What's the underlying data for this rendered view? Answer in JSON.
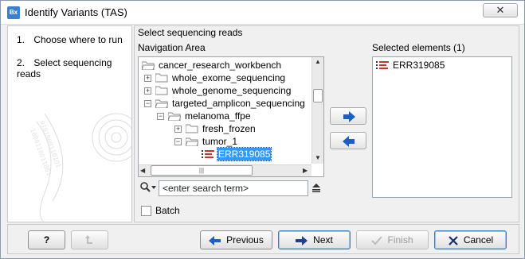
{
  "window": {
    "title": "Identify Variants (TAS)",
    "app_icon_text": "Bx",
    "close_glyph": "✕"
  },
  "steps": [
    {
      "num": "1.",
      "label": "Choose where to run"
    },
    {
      "num": "2.",
      "label": "Select sequencing reads"
    }
  ],
  "main": {
    "section_title": "Select sequencing reads",
    "navigation_label": "Navigation Area",
    "selected_label": "Selected elements (1)"
  },
  "tree": {
    "items": [
      {
        "label": "cancer_research_workbench",
        "icon": "folder-open-icon",
        "expander": ""
      },
      {
        "label": "whole_exome_sequencing",
        "icon": "folder-icon",
        "expander": "+"
      },
      {
        "label": "whole_genome_sequencing",
        "icon": "folder-icon",
        "expander": "+"
      },
      {
        "label": "targeted_amplicon_sequencing",
        "icon": "folder-open-icon",
        "expander": "−"
      },
      {
        "label": "melanoma_ffpe",
        "icon": "folder-open-icon",
        "expander": "−"
      },
      {
        "label": "fresh_frozen",
        "icon": "folder-icon",
        "expander": "+"
      },
      {
        "label": "tumor_1",
        "icon": "folder-open-icon",
        "expander": "−"
      },
      {
        "label": "ERR319085",
        "icon": "sequence-list-icon",
        "expander": "",
        "selected": true
      }
    ]
  },
  "selected_elements": [
    {
      "label": "ERR319085",
      "icon": "sequence-list-icon"
    }
  ],
  "search": {
    "placeholder": "<enter search term>"
  },
  "batch": {
    "label": "Batch",
    "checked": false
  },
  "footer": {
    "help_label": "?",
    "previous_label": "Previous",
    "next_label": "Next",
    "finish_label": "Finish",
    "cancel_label": "Cancel"
  },
  "colors": {
    "selection": "#3399ff",
    "accent_blue": "#1f5fbf",
    "cancel_red": "#1a2f6e",
    "sequence_red": "#c0392b"
  }
}
